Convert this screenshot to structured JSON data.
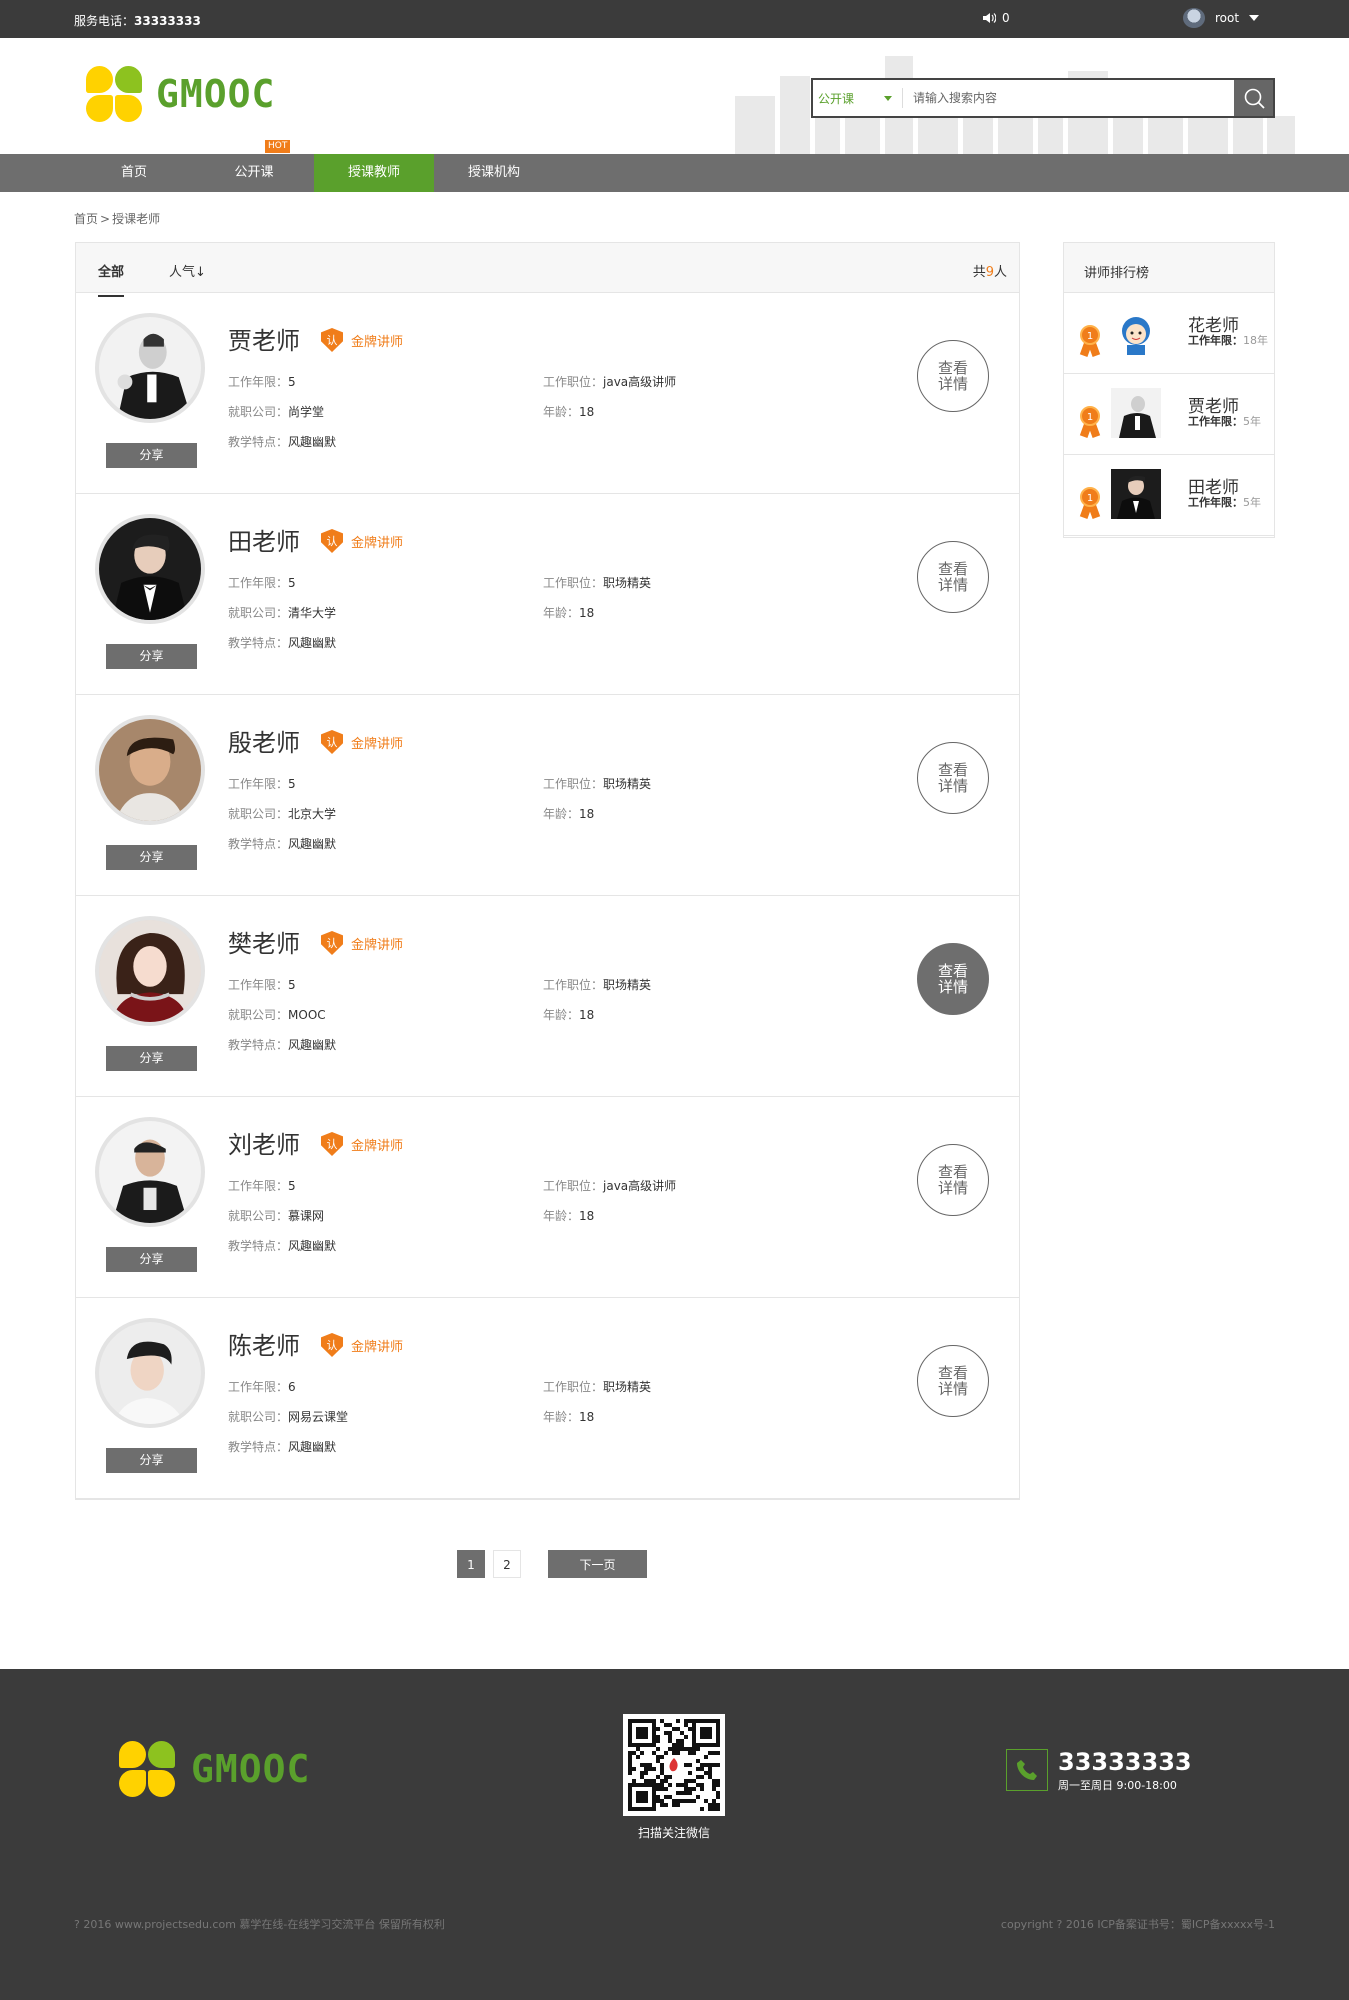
{
  "topbar": {
    "phone_label": "服务电话：",
    "phone_number": "33333333",
    "notice_count": "0",
    "username": "root"
  },
  "header": {
    "logo_text": "GMOOC",
    "search": {
      "category": "公开课",
      "placeholder": "请输入搜索内容"
    }
  },
  "nav": {
    "items": [
      {
        "label": "首页",
        "active": false
      },
      {
        "label": "公开课",
        "active": false
      },
      {
        "label": "授课教师",
        "active": true
      },
      {
        "label": "授课机构",
        "active": false
      }
    ],
    "hot_badge": "HOT"
  },
  "breadcrumb": {
    "home": "首页",
    "sep": ">",
    "current": "授课老师"
  },
  "list": {
    "tab_all": "全部",
    "tab_popular": "人气",
    "tab_popular_arrow": "↓",
    "total_prefix": "共",
    "total_count": "9",
    "total_suffix": "人",
    "labels": {
      "years": "工作年限：",
      "company": "就职公司：",
      "feature": "教学特点：",
      "position": "工作职位：",
      "age": "年龄：",
      "badge_icon": "认",
      "badge": "金牌讲师",
      "share": "分享",
      "detail_line1": "查看",
      "detail_line2": "详情"
    },
    "teachers": [
      {
        "name": "贾老师",
        "years": "5",
        "company": "尚学堂",
        "feature": "风趣幽默",
        "position": "java高级讲师",
        "age": "18"
      },
      {
        "name": "田老师",
        "years": "5",
        "company": "清华大学",
        "feature": "风趣幽默",
        "position": "职场精英",
        "age": "18"
      },
      {
        "name": "殷老师",
        "years": "5",
        "company": "北京大学",
        "feature": "风趣幽默",
        "position": "职场精英",
        "age": "18"
      },
      {
        "name": "樊老师",
        "years": "5",
        "company": "MOOC",
        "feature": "风趣幽默",
        "position": "职场精英",
        "age": "18"
      },
      {
        "name": "刘老师",
        "years": "5",
        "company": "慕课网",
        "feature": "风趣幽默",
        "position": "java高级讲师",
        "age": "18"
      },
      {
        "name": "陈老师",
        "years": "6",
        "company": "网易云课堂",
        "feature": "风趣幽默",
        "position": "职场精英",
        "age": "18"
      }
    ]
  },
  "sidebar": {
    "title": "讲师排行榜",
    "items": [
      {
        "rank": "1",
        "name": "花老师",
        "label": "工作年限：",
        "value": "18年"
      },
      {
        "rank": "1",
        "name": "贾老师",
        "label": "工作年限：",
        "value": "5年"
      },
      {
        "rank": "1",
        "name": "田老师",
        "label": "工作年限：",
        "value": "5年"
      }
    ]
  },
  "pager": {
    "page1": "1",
    "page2": "2",
    "next": "下一页"
  },
  "footer": {
    "logo_text": "GMOOC",
    "qr_caption": "扫描关注微信",
    "phone": "33333333",
    "hours": "周一至周日 9:00-18:00",
    "copyright_left": "? 2016 www.projectsedu.com 慕学在线-在线学习交流平台 保留所有权利",
    "copyright_right": "copyright ? 2016 ICP备案证书号：蜀ICP备xxxxx号-1"
  },
  "colors": {
    "brand_green": "#5aa02c",
    "accent_orange": "#f07d1a",
    "nav_gray": "#6e6e6e",
    "dark_bar": "#3b3b3b"
  }
}
